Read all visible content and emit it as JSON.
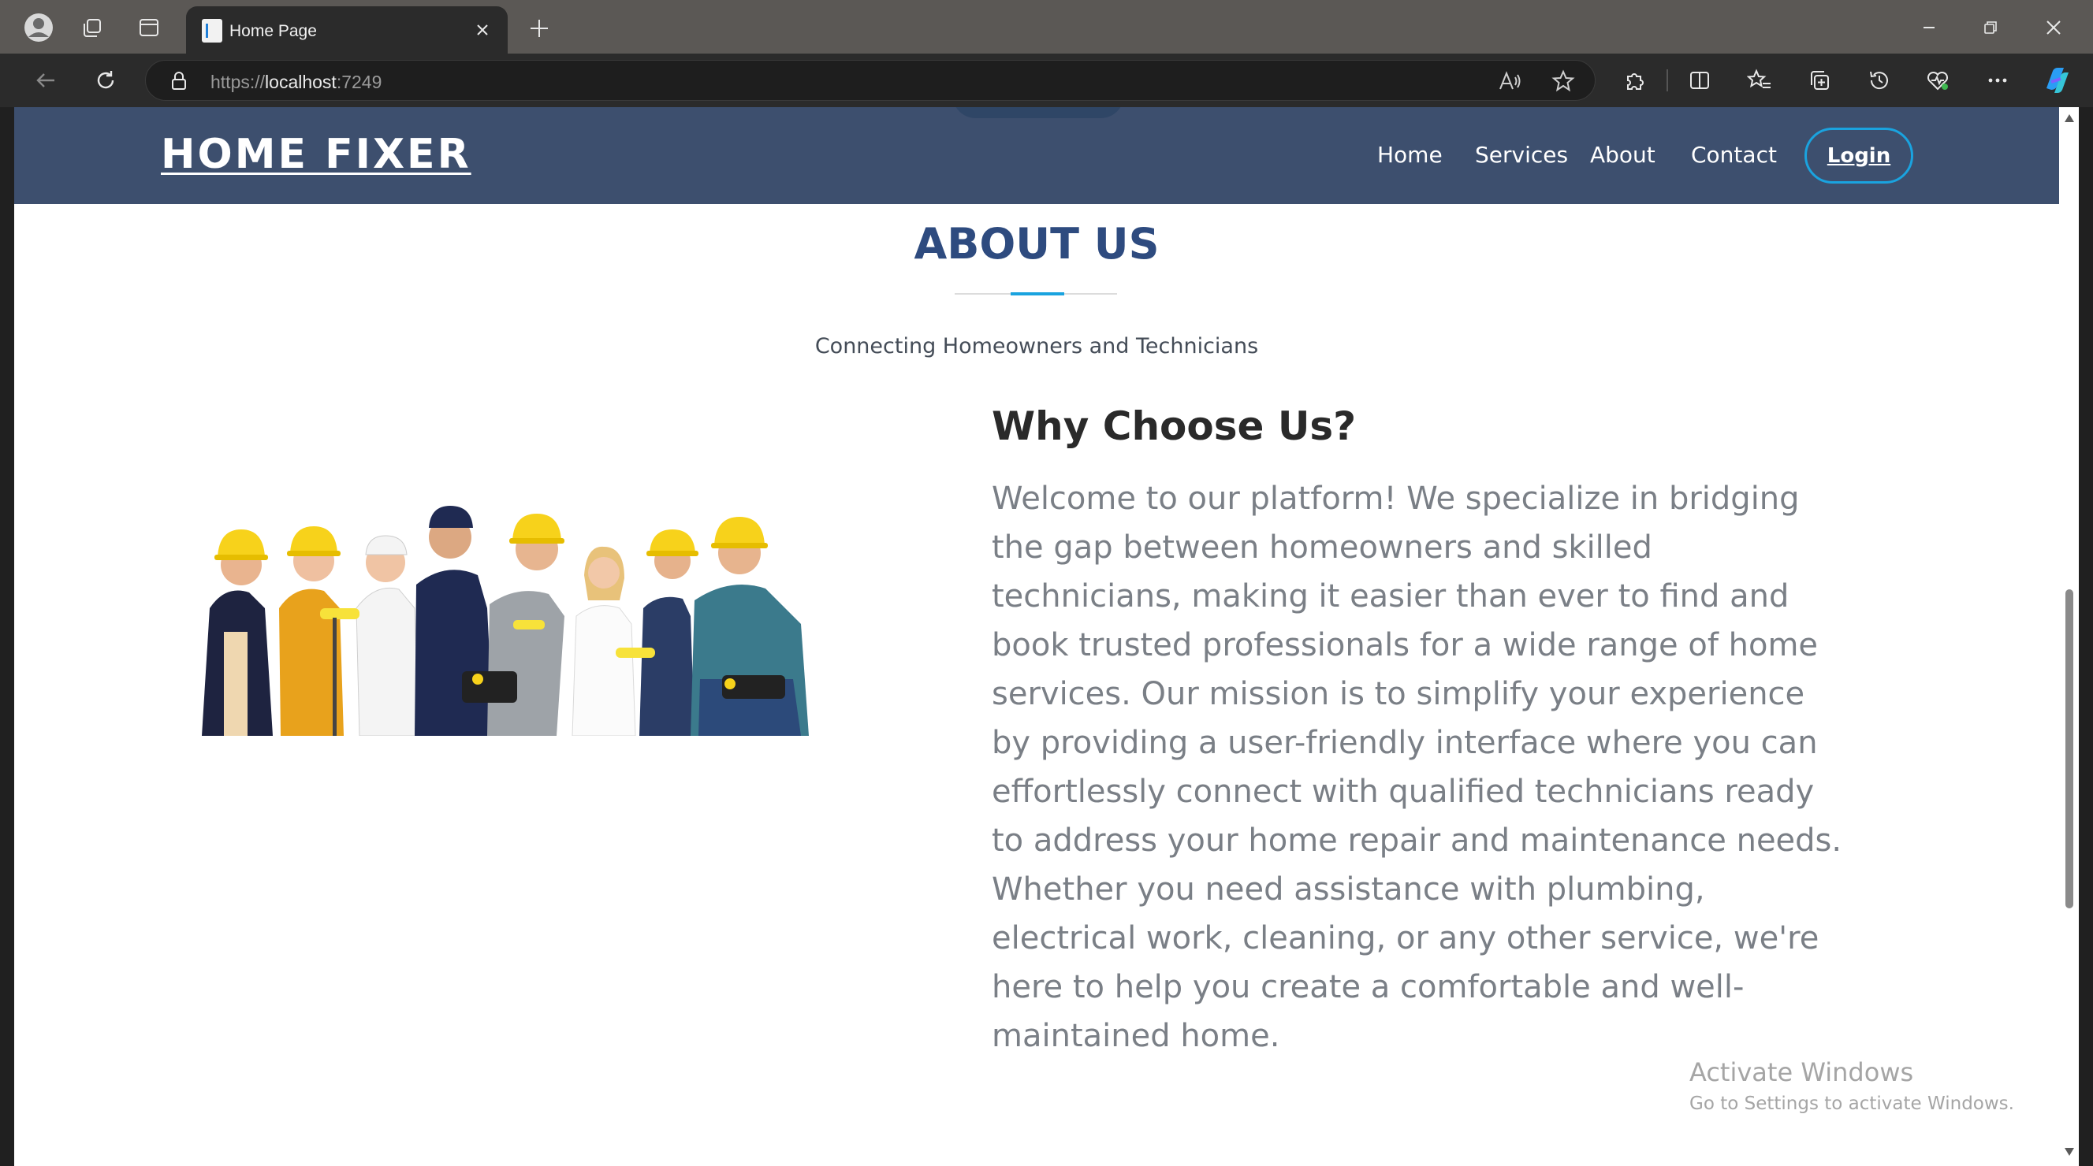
{
  "browser": {
    "tab_title": "Home Page",
    "url_scheme": "https://",
    "url_host": "localhost",
    "url_port": ":7249"
  },
  "site": {
    "logo": "HOME FIXER",
    "nav": [
      "Home",
      "Services",
      "About",
      "Contact"
    ],
    "login": "Login"
  },
  "about": {
    "title": "ABOUT US",
    "subtitle": "Connecting Homeowners and Technicians",
    "heading": "Why Choose Us?",
    "body": "Welcome to our platform! We specialize in bridging the gap between homeowners and skilled technicians, making it easier than ever to find and book trusted professionals for a wide range of home services. Our mission is to simplify your experience by providing a user-friendly interface where you can effortlessly connect with qualified technicians ready to address your home repair and maintenance needs. Whether you need assistance with plumbing, electrical work, cleaning, or any other service, we're here to help you create a comfortable and well-maintained home."
  },
  "overlay": {
    "activate_title": "Activate Windows",
    "activate_sub": "Go to Settings to activate Windows."
  },
  "colors": {
    "header_bg": "#3d4f6e",
    "accent": "#1aa3df",
    "title": "#2e4b7f"
  }
}
